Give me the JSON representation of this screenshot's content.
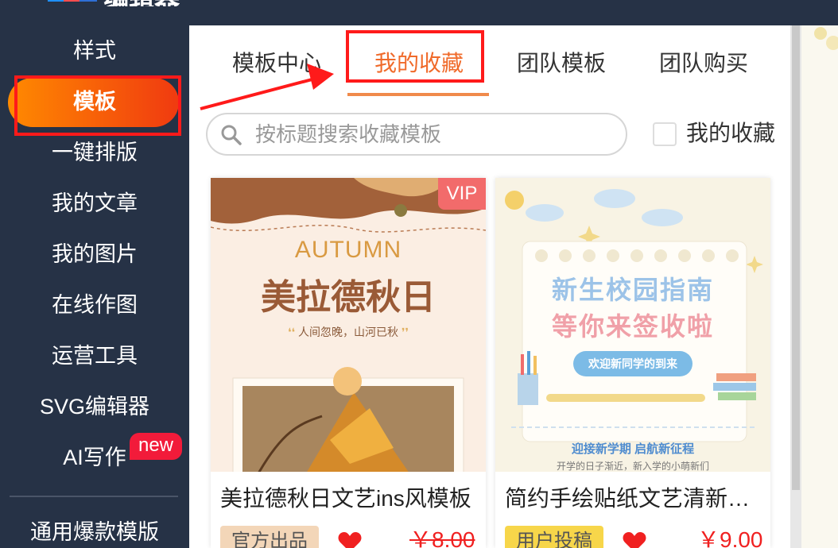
{
  "app": {
    "name": "编辑器"
  },
  "colors": {
    "accent": "#f08a4b",
    "sidebar_bg": "#263246",
    "highlight_box": "#ff1a1a",
    "price": "#f02020"
  },
  "sidebar": {
    "items": [
      {
        "label": "样式"
      },
      {
        "label": "模板",
        "active": true
      },
      {
        "label": "一键排版"
      },
      {
        "label": "我的文章"
      },
      {
        "label": "我的图片"
      },
      {
        "label": "在线作图"
      },
      {
        "label": "运营工具"
      },
      {
        "label": "SVG编辑器"
      },
      {
        "label": "AI写作",
        "badge": "new"
      },
      {
        "label": "通用爆款模版"
      }
    ]
  },
  "tabs": [
    {
      "label": "模板中心"
    },
    {
      "label": "我的收藏",
      "active": true
    },
    {
      "label": "团队模板"
    },
    {
      "label": "团队购买"
    }
  ],
  "search": {
    "placeholder": "按标题搜索收藏模板",
    "icon": "search-icon"
  },
  "filter": {
    "label": "我的收藏",
    "checked": false
  },
  "cards": [
    {
      "title": "美拉德秋日文艺ins风模板",
      "vip": "VIP",
      "tag": "官方出品",
      "price": "￥8.00",
      "strikethrough": true,
      "favorited": true,
      "preview": {
        "heading_en": "AUTUMN",
        "heading_cn": "美拉德秋日",
        "quote": "人间忽晚，山河已秋"
      }
    },
    {
      "title": "简约手绘贴纸文艺清新…",
      "tag": "用户投稿",
      "price": "￥9.00",
      "strikethrough": false,
      "favorited": true,
      "preview": {
        "line1": "新生校园指南",
        "line2": "等你来签收啦",
        "pill": "欢迎新同学的到来",
        "footer1": "迎接新学期 启航新征程",
        "footer2": "开学的日子渐近，新入学的小萌新们"
      }
    }
  ]
}
